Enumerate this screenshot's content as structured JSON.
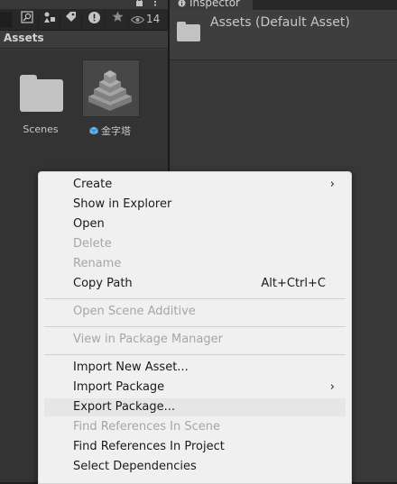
{
  "project": {
    "toolbar": {
      "hidden_count": "14"
    },
    "breadcrumb": "Assets",
    "assets": [
      {
        "name": "Scenes",
        "type": "folder"
      },
      {
        "name": "金字塔",
        "type": "prefab"
      }
    ]
  },
  "inspector": {
    "tab_label": "Inspector",
    "title": "Assets (Default Asset)"
  },
  "context_menu": {
    "items": [
      {
        "label": "Create",
        "submenu": true
      },
      {
        "label": "Show in Explorer"
      },
      {
        "label": "Open"
      },
      {
        "label": "Delete",
        "disabled": true
      },
      {
        "label": "Rename",
        "disabled": true
      },
      {
        "label": "Copy Path",
        "shortcut": "Alt+Ctrl+C"
      },
      {
        "label": "Open Scene Additive",
        "disabled": true
      },
      {
        "label": "View in Package Manager",
        "disabled": true
      },
      {
        "label": "Import New Asset..."
      },
      {
        "label": "Import Package",
        "submenu": true
      },
      {
        "label": "Export Package...",
        "highlighted": true
      },
      {
        "label": "Find References In Scene",
        "disabled": true
      },
      {
        "label": "Find References In Project"
      },
      {
        "label": "Select Dependencies"
      }
    ],
    "submenu_glyph": "›"
  },
  "colors": {
    "panel_bg": "#383838",
    "menu_bg": "#f0f0f0",
    "menu_disabled_text": "#a6a6a6",
    "menu_highlight": "#e6e6e6",
    "folder_icon": "#c2c2c2",
    "prefab_icon": "#5fb4ec"
  },
  "icons": {
    "toolbar": [
      "search-filter-icon",
      "scene-filter-icon",
      "label-tag-icon",
      "error-icon",
      "favorite-star-icon",
      "eye-icon"
    ],
    "top": [
      "lock-icon",
      "more-menu-icon"
    ],
    "inspector_tab": "info-icon"
  }
}
